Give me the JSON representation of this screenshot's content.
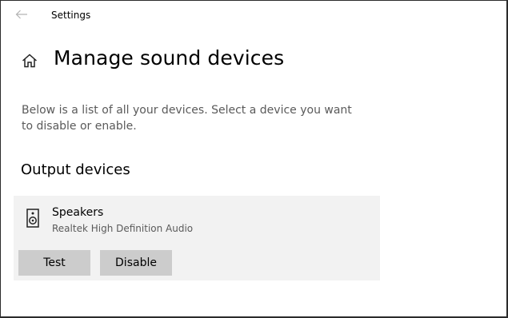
{
  "window": {
    "title": "Settings"
  },
  "header": {
    "title": "Manage sound devices"
  },
  "description": "Below is a list of all your devices. Select a device you want to disable or enable.",
  "output_section": {
    "heading": "Output devices",
    "devices": [
      {
        "name": "Speakers",
        "driver": "Realtek High Definition Audio",
        "icon": "speaker-icon",
        "test_label": "Test",
        "disable_label": "Disable"
      }
    ]
  },
  "icons": {
    "back": "back-arrow-icon",
    "home": "home-icon"
  },
  "colors": {
    "card_background": "#f2f2f2",
    "button_background": "#cccccc",
    "secondary_text": "#5a5a5a"
  }
}
